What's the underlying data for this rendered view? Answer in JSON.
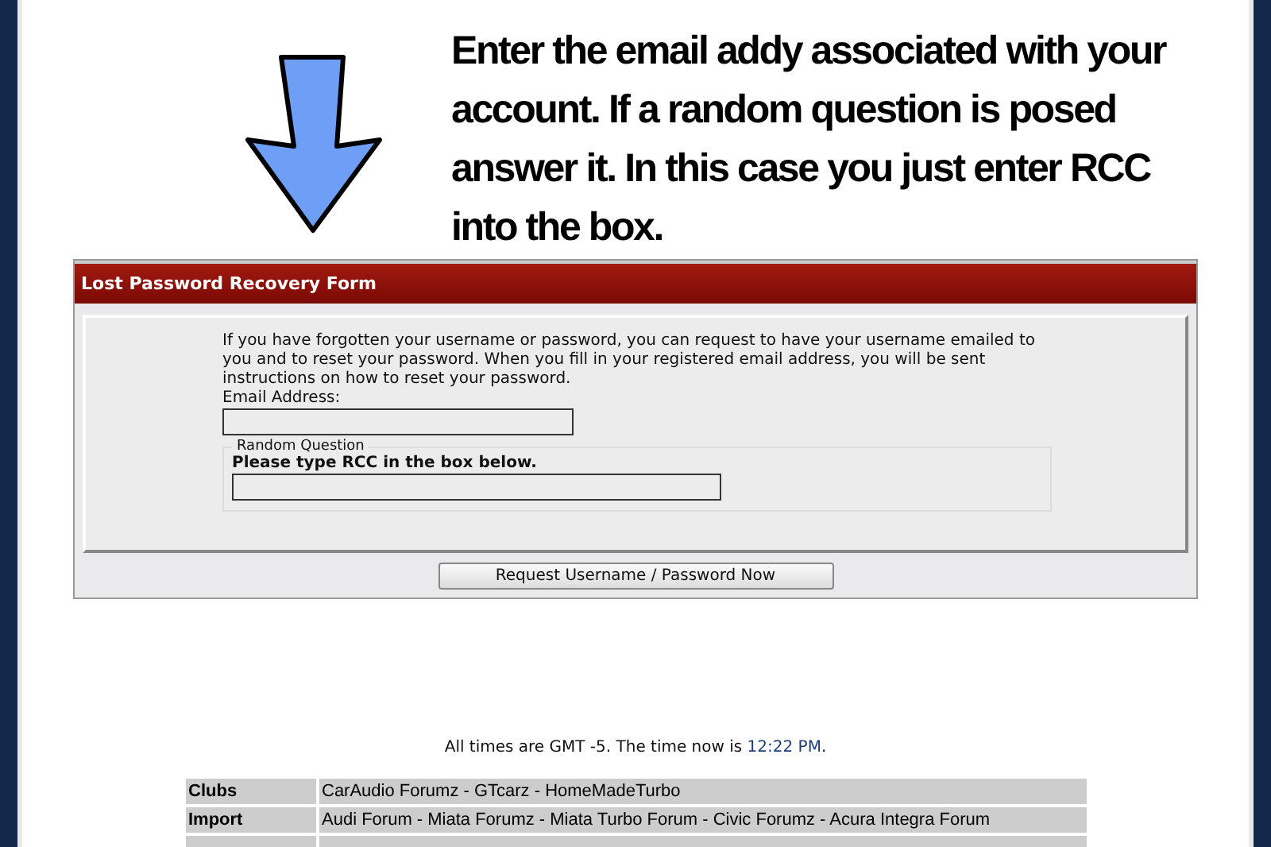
{
  "annotation": {
    "text": "Enter the email addy associated with your account. If a random question is posed answer it. In this case you just enter RCC into the box."
  },
  "form": {
    "title": "Lost Password Recovery Form",
    "intro": "If you have forgotten your username or password, you can request to have your username emailed to you and to reset your password. When you fill in your registered email address, you will be sent instructions on how to reset your password.",
    "email_label": "Email Address:",
    "random_question": {
      "legend": "Random Question",
      "prompt": "Please type RCC in the box below."
    },
    "submit_button": "Request Username / Password Now"
  },
  "footer": {
    "time_note": "All times are GMT -5. The time now is ",
    "time": "12:22 PM",
    "time_end": ".",
    "links_table": [
      {
        "category": "Clubs",
        "links": "CarAudio Forumz - GTcarz - HomeMadeTurbo"
      },
      {
        "category": "Import",
        "links": "Audi Forum - Miata Forumz - Miata Turbo Forum - Civic Forumz - Acura Integra Forum"
      }
    ]
  }
}
